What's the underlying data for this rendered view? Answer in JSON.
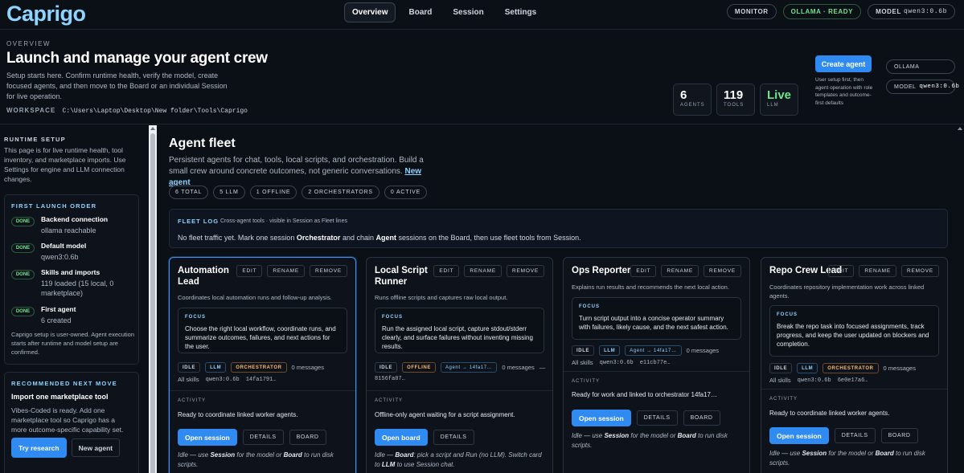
{
  "app": {
    "logo": "Caprigo"
  },
  "nav": {
    "tabs": [
      "Overview",
      "Board",
      "Session",
      "Settings"
    ]
  },
  "top_right": {
    "monitor": "MONITOR",
    "ollama_status": "OLLAMA · READY",
    "model_label": "MODEL",
    "model_value": "qwen3:0.6b"
  },
  "overview": {
    "eyebrow": "OVERVIEW",
    "title": "Launch and manage your agent crew",
    "desc": "Setup starts here. Confirm runtime health, verify the model, create focused agents, and then move to the Board or an individual Session for live operation.",
    "workspace_label": "WORKSPACE",
    "workspace_path": "C:\\Users\\Laptop\\Desktop\\New folder\\Tools\\Caprigo",
    "stats": [
      {
        "value": "6",
        "label": "AGENTS"
      },
      {
        "value": "119",
        "label": "TOOLS"
      },
      {
        "value": "Live",
        "label": "LLM"
      }
    ],
    "create_button": "Create agent",
    "create_note": "User setup first, then agent operation with role templates and outcome-first defaults",
    "runtime_pill": "OLLAMA",
    "model_pill_label": "MODEL",
    "model_pill_value": "qwen3:0.6b"
  },
  "sidebar": {
    "runtime_eyebrow": "RUNTIME SETUP",
    "runtime_text": "This page is for live runtime health, tool inventory, and marketplace imports. Use Settings for engine and LLM connection changes.",
    "first_launch_eyebrow": "FIRST LAUNCH ORDER",
    "done_label": "DONE",
    "steps": [
      {
        "title": "Backend connection",
        "detail": "ollama reachable"
      },
      {
        "title": "Default model",
        "detail": "qwen3:0.6b"
      },
      {
        "title": "Skills and imports",
        "detail": "119 loaded (15 local, 0 marketplace)"
      },
      {
        "title": "First agent",
        "detail": "6 created"
      }
    ],
    "launch_note": "Caprigo setup is user-owned. Agent execution starts after runtime and model setup are confirmed.",
    "recommended_eyebrow": "RECOMMENDED NEXT MOVE",
    "recommended_title": "Import one marketplace tool",
    "recommended_text": "Vibes-Coded is ready. Add one marketplace tool so Caprigo has a more outcome-specific capability set.",
    "try_research": "Try research",
    "new_agent": "New agent"
  },
  "main": {
    "title": "Agent fleet",
    "desc": "Persistent agents for chat, tools, local scripts, and orchestration. Build a small crew around concrete outcomes, not generic conversations.",
    "new_agent_link": "New agent",
    "chips": [
      "6 TOTAL",
      "5 LLM",
      "1 OFFLINE",
      "2 ORCHESTRATORS",
      "0 ACTIVE"
    ],
    "fleet_log": {
      "label": "FLEET LOG",
      "sub": "Cross-agent tools · visible in Session as Fleet lines",
      "msg_1": "No fleet traffic yet. Mark one session ",
      "msg_b1": "Orchestrator",
      "msg_2": " and chain ",
      "msg_b2": "Agent",
      "msg_3": " sessions on the Board, then use fleet tools from Session."
    }
  },
  "common": {
    "edit": "EDIT",
    "rename": "RENAME",
    "remove": "REMOVE",
    "focus": "FOCUS",
    "activity": "ACTIVITY",
    "idle": "IDLE",
    "llm": "LLM",
    "details": "DETAILS",
    "board": "BOARD",
    "open_session": "Open session",
    "idle_pre": "Idle — use ",
    "idle_session": "Session",
    "idle_mid": " for the model or ",
    "idle_board": "Board",
    "idle_post": " to run disk scripts."
  },
  "agents": [
    {
      "name": "Automation Lead",
      "summary": "Coordinates local automation runs and follow-up analysis.",
      "focus": "Choose the right local workflow, coordinate runs, and summarize outcomes, failures, and next actions for the user.",
      "role_tag": "ORCHESTRATOR",
      "messages": "0 messages",
      "skills": "All skills",
      "model": "qwen3:0.6b",
      "id": "14fa1791…",
      "activity": "Ready to coordinate linked worker agents."
    },
    {
      "name": "Local Script Runner",
      "summary": "Runs offline scripts and captures raw local output.",
      "focus": "Run the assigned local script, capture stdout/stderr clearly, and surface failures without inventing missing results.",
      "offline_tag": "OFFLINE",
      "link_tag": "Agent → 14fa17…",
      "messages": "0 messages",
      "dash": "—",
      "id": "8156fa07…",
      "activity": "Offline-only agent waiting for a script assignment.",
      "open_board": "Open board",
      "note_pre": "Idle — ",
      "note_board": "Board",
      "note_mid": ": pick a script and Run (no LLM). Switch card to ",
      "note_llm": "LLM",
      "note_post": " to use Session chat."
    },
    {
      "name": "Ops Reporter",
      "summary": "Explains run results and recommends the next local action.",
      "focus": "Turn script output into a concise operator summary with failures, likely cause, and the next safest action.",
      "link_tag": "Agent → 14fa17…",
      "messages": "0 messages",
      "skills": "All skills",
      "model": "qwen3:0.6b",
      "id": "e11cb77e…",
      "activity": "Ready for work and linked to orchestrator 14fa17…"
    },
    {
      "name": "Repo Crew Lead",
      "summary": "Coordinates repository implementation work across linked agents.",
      "focus": "Break the repo task into focused assignments, track progress, and keep the user updated on blockers and completion.",
      "role_tag": "ORCHESTRATOR",
      "messages": "0 messages",
      "skills": "All skills",
      "model": "qwen3:0.6b",
      "id": "6e0e17a6…",
      "activity": "Ready to coordinate linked worker agents."
    }
  ]
}
